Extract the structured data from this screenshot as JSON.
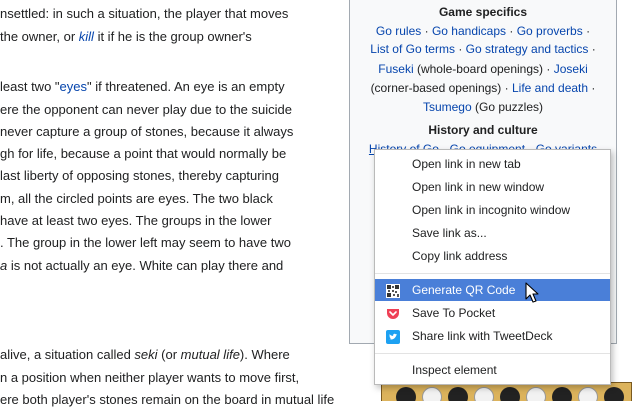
{
  "article": {
    "lines": [
      [
        "nsettled: in such a situation, the player that moves"
      ],
      [
        "the owner, or ",
        "kill",
        " it if he is the group owner's"
      ],
      [
        ""
      ],
      [
        "least two \"",
        "eyes",
        "\" if threatened. An eye is an empty"
      ],
      [
        "ere the opponent can never play due to the suicide"
      ],
      [
        "never capture a group of stones, because it always"
      ],
      [
        "gh for life, because a point that would normally be"
      ],
      [
        " last liberty of opposing stones, thereby capturing"
      ],
      [
        "m, all the circled points are eyes. The two black"
      ],
      [
        "have at least two eyes. The groups in the lower"
      ],
      [
        ". The group in the lower left may seem to have two"
      ],
      [
        "a",
        " is not actually an eye. White can play there and"
      ],
      [
        ""
      ],
      [
        ""
      ],
      [
        ""
      ],
      [
        "alive, a situation called ",
        "seki",
        " (or ",
        "mutual life",
        "). Where"
      ],
      [
        "n a position when neither player wants to move first,"
      ],
      [
        "ere both player's stones remain on the board in mutual life"
      ]
    ]
  },
  "navbox": {
    "game_specifics_title": "Game specifics",
    "go_rules": "Go rules",
    "go_handicaps": "Go handicaps",
    "go_proverbs": "Go proverbs",
    "list_of_go_terms": "List of Go terms",
    "go_strategy": "Go strategy and tactics",
    "fuseki": "Fuseki",
    "fuseki_note": "(whole-board openings)",
    "joseki": "Joseki",
    "joseki_note": "(corner-based openings)",
    "life_and_death": "Life and death",
    "tsumego": "Tsumego",
    "tsumego_note": "(Go puzzles)",
    "history_title": "History and culture",
    "history_of_go": "History of Go",
    "go_equipment": "Go equipment",
    "go_variants": "Go variants",
    "separator": "·"
  },
  "context_menu": {
    "items": [
      {
        "label": "Open link in new tab"
      },
      {
        "label": "Open link in new window"
      },
      {
        "label": "Open link in incognito window"
      },
      {
        "label": "Save link as..."
      },
      {
        "label": "Copy link address"
      },
      {
        "label": "Generate QR Code",
        "icon": "qr-code-icon",
        "highlighted": true
      },
      {
        "label": "Save To Pocket",
        "icon": "pocket-icon"
      },
      {
        "label": "Share link with TweetDeck",
        "icon": "tweetdeck-icon"
      },
      {
        "label": "Inspect element"
      }
    ]
  },
  "colors": {
    "link": "#0645ad",
    "highlight": "#4a7fd8",
    "pocket": "#ef4056",
    "tweetdeck": "#1da1f2"
  }
}
